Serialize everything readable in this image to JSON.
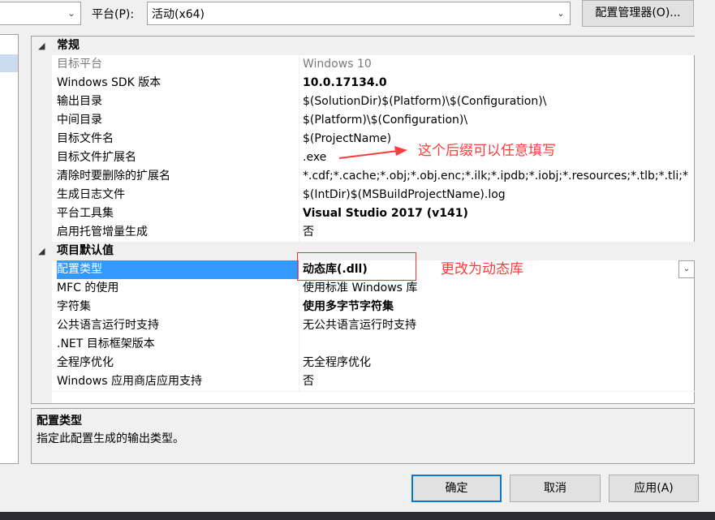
{
  "toolbar": {
    "platform_label": "平台(P):",
    "platform_value": "活动(x64)",
    "config_manager_label": "配置管理器(O)..."
  },
  "grid": {
    "general": {
      "title": "常规",
      "rows": [
        {
          "name": "目标平台",
          "value": "Windows 10"
        },
        {
          "name": "Windows SDK 版本",
          "value": "10.0.17134.0"
        },
        {
          "name": "输出目录",
          "value": "$(SolutionDir)$(Platform)\\$(Configuration)\\"
        },
        {
          "name": "中间目录",
          "value": "$(Platform)\\$(Configuration)\\"
        },
        {
          "name": "目标文件名",
          "value": "$(ProjectName)"
        },
        {
          "name": "目标文件扩展名",
          "value": ".exe"
        },
        {
          "name": "清除时要删除的扩展名",
          "value": "*.cdf;*.cache;*.obj;*.obj.enc;*.ilk;*.ipdb;*.iobj;*.resources;*.tlb;*.tli;*"
        },
        {
          "name": "生成日志文件",
          "value": "$(IntDir)$(MSBuildProjectName).log"
        },
        {
          "name": "平台工具集",
          "value": "Visual Studio 2017 (v141)"
        },
        {
          "name": "启用托管增量生成",
          "value": "否"
        }
      ]
    },
    "defaults": {
      "title": "项目默认值",
      "rows": [
        {
          "name": "配置类型",
          "value": "动态库(.dll)"
        },
        {
          "name": "MFC 的使用",
          "value": "使用标准 Windows 库"
        },
        {
          "name": "字符集",
          "value": "使用多字节字符集"
        },
        {
          "name": "公共语言运行时支持",
          "value": "无公共语言运行时支持"
        },
        {
          "name": ".NET 目标框架版本",
          "value": ""
        },
        {
          "name": "全程序优化",
          "value": "无全程序优化"
        },
        {
          "name": "Windows 应用商店应用支持",
          "value": "否"
        }
      ]
    }
  },
  "annotations": {
    "extension_note": "这个后缀可以任意填写",
    "config_type_note": "更改为动态库"
  },
  "description": {
    "title": "配置类型",
    "text": "指定此配置生成的输出类型。"
  },
  "buttons": {
    "ok": "确定",
    "cancel": "取消",
    "apply": "应用(A)"
  },
  "colors": {
    "selection": "#3399ff",
    "annotation_red": "#ff3b3b",
    "focus_border": "#0078d7"
  }
}
